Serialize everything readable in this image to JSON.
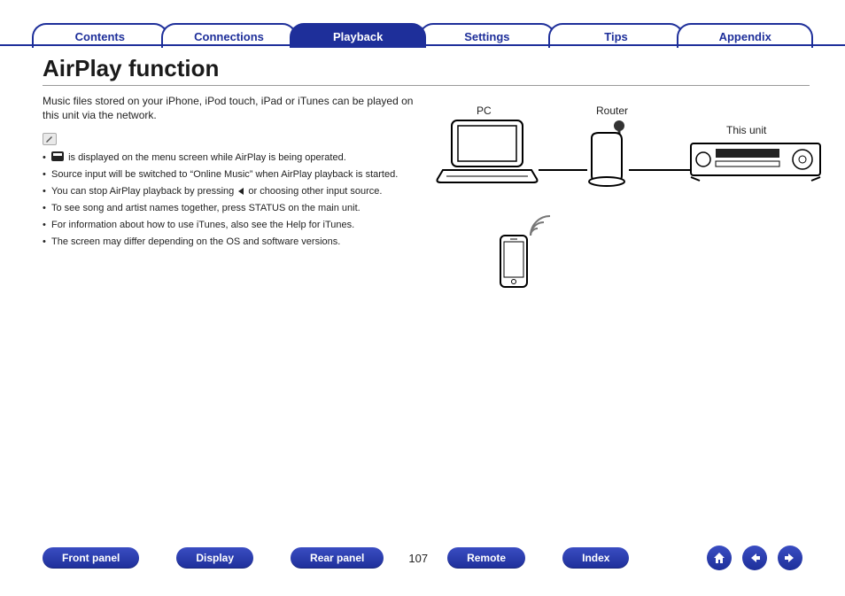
{
  "tabs": {
    "contents": "Contents",
    "connections": "Connections",
    "playback": "Playback",
    "settings": "Settings",
    "tips": "Tips",
    "appendix": "Appendix"
  },
  "heading": "AirPlay function",
  "intro": "Music files stored on your iPhone, iPod touch, iPad or iTunes can be played on this unit via the network.",
  "bullets": {
    "b1a": "is displayed on the menu screen while AirPlay is being operated.",
    "b2": "Source input will be switched to “Online Music” when AirPlay playback is started.",
    "b3a": "You can stop AirPlay playback by pressing",
    "b3b": "or choosing other input source.",
    "b4": "To see song and artist names together, press STATUS on the main unit.",
    "b5": "For information about how to use iTunes, also see the Help for iTunes.",
    "b6": "The screen may differ depending on the OS and software versions."
  },
  "diagram": {
    "pc": "PC",
    "router": "Router",
    "unit": "This unit"
  },
  "bottom": {
    "front": "Front panel",
    "display": "Display",
    "rear": "Rear panel",
    "remote": "Remote",
    "index": "Index",
    "page": "107"
  }
}
